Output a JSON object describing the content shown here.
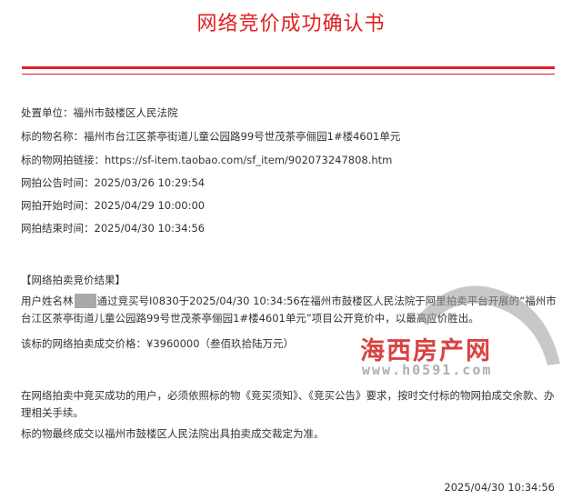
{
  "document": {
    "title": "网络竞价成功确认书",
    "fields": [
      {
        "label": "处置单位：",
        "value": "福州市鼓楼区人民法院"
      },
      {
        "label": "标的物名称：",
        "value": "福州市台江区茶亭街道儿童公园路99号世茂茶亭俪园1#楼4601单元"
      },
      {
        "label": "标的物网拍链接：",
        "value": "https://sf-item.taobao.com/sf_item/902073247808.htm"
      },
      {
        "label": "网拍公告时间：",
        "value": "2025/03/26 10:29:54"
      },
      {
        "label": "网拍开始时间：",
        "value": "2025/04/29 10:00:00"
      },
      {
        "label": "网拍结束时间：",
        "value": "2025/04/30 10:34:56"
      }
    ],
    "result_heading": "【网络拍卖竞价结果】",
    "result_text_prefix": "用户姓名林",
    "result_text_body": "通过竞买号I0830于2025/04/30 10:34:56在福州市鼓楼区人民法院于阿里拍卖平台开展的“福州市台江区茶亭街道儿童公园路99号世茂茶亭俪园1#楼4601单元”项目公开竞价中，以最高应价胜出。",
    "price_line": "该标的网络拍卖成交价格：¥3960000（叁佰玖拾陆万元）",
    "notice_1": "在网络拍卖中竞买成功的用户，必须依照标的物《竞买须知》、《竞买公告》要求，按时交付标的物网拍成交余款、办理相关手续。",
    "notice_2": "标的物最终成交以福州市鼓楼区人民法院出具拍卖成交裁定为准。",
    "footer_time": "2025/04/30 10:34:56"
  },
  "watermark": {
    "text": "海西房产网",
    "url": "www.h0591.com"
  },
  "colors": {
    "accent": "#e02020",
    "text": "#333333",
    "redaction": "#a9a9a9"
  }
}
